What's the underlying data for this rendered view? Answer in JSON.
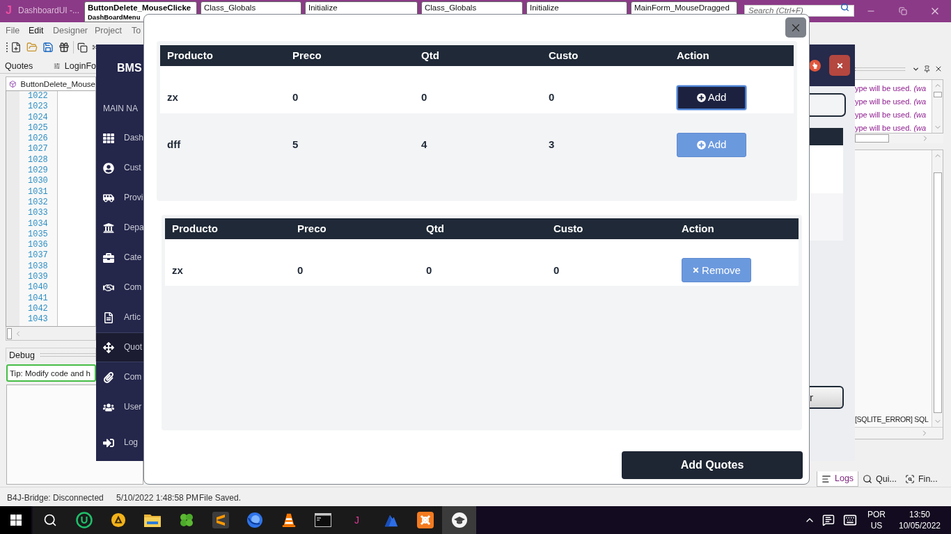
{
  "ide": {
    "title_bar": {
      "logo": "J",
      "app_title": "DashboardUI -...",
      "tabs": [
        {
          "title": "ButtonDelete_MouseClicke",
          "subtitle": "DashBoardMenu",
          "selected": true
        },
        {
          "title": "Class_Globals",
          "selected": false
        },
        {
          "title": "Initialize",
          "selected": false
        },
        {
          "title": "Class_Globals",
          "selected": false
        },
        {
          "title": "Initialize",
          "selected": false
        },
        {
          "title": "MainForm_MouseDragged",
          "selected": false
        }
      ],
      "search": {
        "placeholder": "Search (Ctrl+F)"
      }
    },
    "menu": [
      {
        "label": "File",
        "active": false
      },
      {
        "label": "Edit",
        "active": true
      },
      {
        "label": "Designer",
        "active": false
      },
      {
        "label": "Project",
        "active": false
      },
      {
        "label": "To",
        "active": false
      }
    ],
    "panel_tabs": [
      "Quotes",
      "LoginFo"
    ],
    "module_tab": "ButtonDelete_Mouse",
    "line_numbers": [
      "1022",
      "1023",
      "1024",
      "1025",
      "1026",
      "1027",
      "1028",
      "1029",
      "1030",
      "1031",
      "1032",
      "1033",
      "1034",
      "1035",
      "1036",
      "1037",
      "1038",
      "1039",
      "1040",
      "1041",
      "1042",
      "1043"
    ],
    "debug": {
      "title": "Debug",
      "tip": "Tip: Modify code and h"
    },
    "logs": {
      "lines": [
        "ype will be used. *(wa*",
        "ype will be used. *(wa*",
        "ype will be used. *(wa*",
        "ype will be used. *(wa*"
      ],
      "error_line": "[SQLITE_ERROR] SQL",
      "tabs": [
        {
          "label": "Logs",
          "selected": true
        },
        {
          "label": "Qui...",
          "selected": false
        },
        {
          "label": "Fin...",
          "selected": false
        }
      ]
    },
    "status_bar": [
      "B4J-Bridge: Disconnected",
      "5/10/2022 1:48:58 PM",
      "File Saved."
    ]
  },
  "dashboard": {
    "brand": "BMS",
    "nav_heading": "MAIN NA",
    "nav": [
      {
        "label": "Dash",
        "selected": false
      },
      {
        "label": "Cust",
        "selected": false
      },
      {
        "label": "Provi",
        "selected": false
      },
      {
        "label": "Depa",
        "selected": false
      },
      {
        "label": "Cate",
        "selected": false
      },
      {
        "label": "Com",
        "selected": false
      },
      {
        "label": "Artic",
        "selected": false
      },
      {
        "label": "Quot",
        "selected": true
      },
      {
        "label": "Com",
        "selected": false
      },
      {
        "label": "User",
        "selected": false
      },
      {
        "label": "Log",
        "selected": false
      }
    ],
    "side_button_text": "r"
  },
  "modal": {
    "tables": [
      {
        "columns": [
          "Producto",
          "Preco",
          "Qtd",
          "Custo",
          "Action"
        ],
        "rows": [
          {
            "cells": [
              "zx",
              "0",
              "0",
              "0"
            ],
            "action": {
              "label": "Add",
              "kind": "add",
              "focused": true
            }
          },
          {
            "cells": [
              "dff",
              "5",
              "4",
              "3"
            ],
            "action": {
              "label": "Add",
              "kind": "add",
              "focused": false
            }
          }
        ]
      },
      {
        "columns": [
          "Producto",
          "Preco",
          "Qtd",
          "Custo",
          "Action"
        ],
        "rows": [
          {
            "cells": [
              "zx",
              "0",
              "0",
              "0"
            ],
            "action": {
              "label": "Remove",
              "kind": "remove",
              "focused": false
            }
          }
        ]
      }
    ],
    "submit": "Add Quotes"
  },
  "taskbar": {
    "app_glyph": "J",
    "tray": {
      "input_language": "POR",
      "keyboard_layout": "US",
      "time": "13:50",
      "date": "10/05/2022"
    }
  }
}
